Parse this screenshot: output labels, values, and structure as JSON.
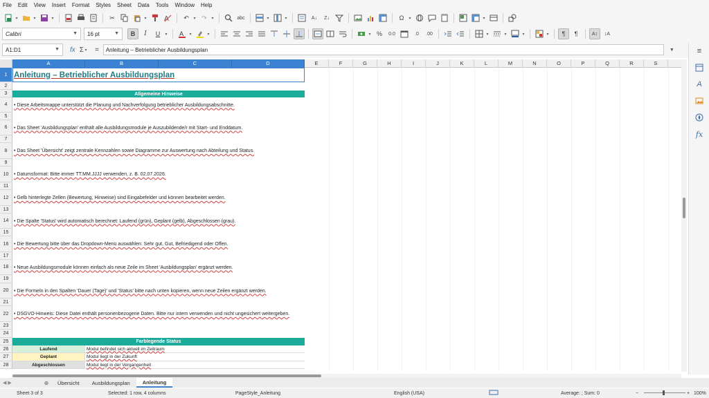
{
  "menu": [
    "File",
    "Edit",
    "View",
    "Insert",
    "Format",
    "Styles",
    "Sheet",
    "Data",
    "Tools",
    "Window",
    "Help"
  ],
  "toolbar": {
    "font_name": "Calibri",
    "font_size": "16 pt"
  },
  "formula_bar": {
    "name_box": "A1:D1",
    "content": "Anleitung – Betrieblicher Ausbildungsplan"
  },
  "columns": [
    "A",
    "B",
    "C",
    "D",
    "E",
    "F",
    "G",
    "H",
    "I",
    "J",
    "K",
    "L",
    "M",
    "N",
    "O",
    "P",
    "Q",
    "R",
    "S"
  ],
  "rows": [
    "1",
    "2",
    "3",
    "4",
    "5",
    "6",
    "7",
    "8",
    "9",
    "10",
    "11",
    "12",
    "13",
    "14",
    "15",
    "16",
    "17",
    "18",
    "19",
    "20",
    "21",
    "22",
    "23",
    "24",
    "25",
    "26",
    "27",
    "28"
  ],
  "sheet": {
    "title": "Anleitung – Betrieblicher Ausbildungsplan",
    "section_general": "Allgemeine Hinweise",
    "notes": [
      "• Diese Arbeitsmappe unterstützt die Planung und Nachverfolgung betrieblicher Ausbildungsabschnitte.",
      "• Das Sheet 'Ausbildungsplan' enthält alle Ausbildungsmodule je Auszubildende/r mit Start- und Enddatum.",
      "• Das Sheet 'Übersicht' zeigt zentrale Kennzahlen sowie Diagramme zur Auswertung nach Abteilung und Status.",
      "• Datumsformat: Bitte immer TT.MM.JJJJ verwenden, z. B. 02.07.2026.",
      "• Gelb hinterlegte Zellen (Bewertung, Hinweise) sind Eingabefelder und können bearbeitet werden.",
      "• Die Spalte 'Status' wird automatisch berechnet: Laufend (grün), Geplant (gelb), Abgeschlossen (grau).",
      "• Die Bewertung bitte über das Dropdown-Menü auswählen: Sehr gut, Gut, Befriedigend oder Offen.",
      "• Neue Ausbildungsmodule können einfach als neue Zeile im Sheet 'Ausbildungsplan' ergänzt werden.",
      "• Die Formeln in den Spalten 'Dauer (Tage)' und 'Status' bitte nach unten kopieren, wenn neue Zeilen ergänzt werden.",
      "• DSGVO-Hinweis: Diese Datei enthält personenbezogene Daten. Bitte nur intern verwenden und nicht ungesichert weitergeben."
    ],
    "section_legend": "Farblegende Status",
    "legend": [
      {
        "key": "Laufend",
        "text": "Modul befindet sich aktuell im Zeitraum",
        "color": "#d6f0dc"
      },
      {
        "key": "Geplant",
        "text": "Modul liegt in der Zukunft",
        "color": "#fff3c2"
      },
      {
        "key": "Abgeschlossen",
        "text": "Modul liegt in der Vergangenheit",
        "color": "#e0e0e0"
      }
    ]
  },
  "tabs": [
    "Übersicht",
    "Ausbildungsplan",
    "Anleitung"
  ],
  "active_tab": "Anleitung",
  "status": {
    "sheet": "Sheet 3 of 3",
    "selection": "Selected: 1 row, 4 columns",
    "page_style": "PageStyle_Anleitung",
    "language": "English (USA)",
    "summary": "Average: ; Sum: 0",
    "zoom": "100%"
  },
  "colors": {
    "accent": "#3c82d2",
    "band": "#1aab9b",
    "title": "#1f7a84"
  }
}
